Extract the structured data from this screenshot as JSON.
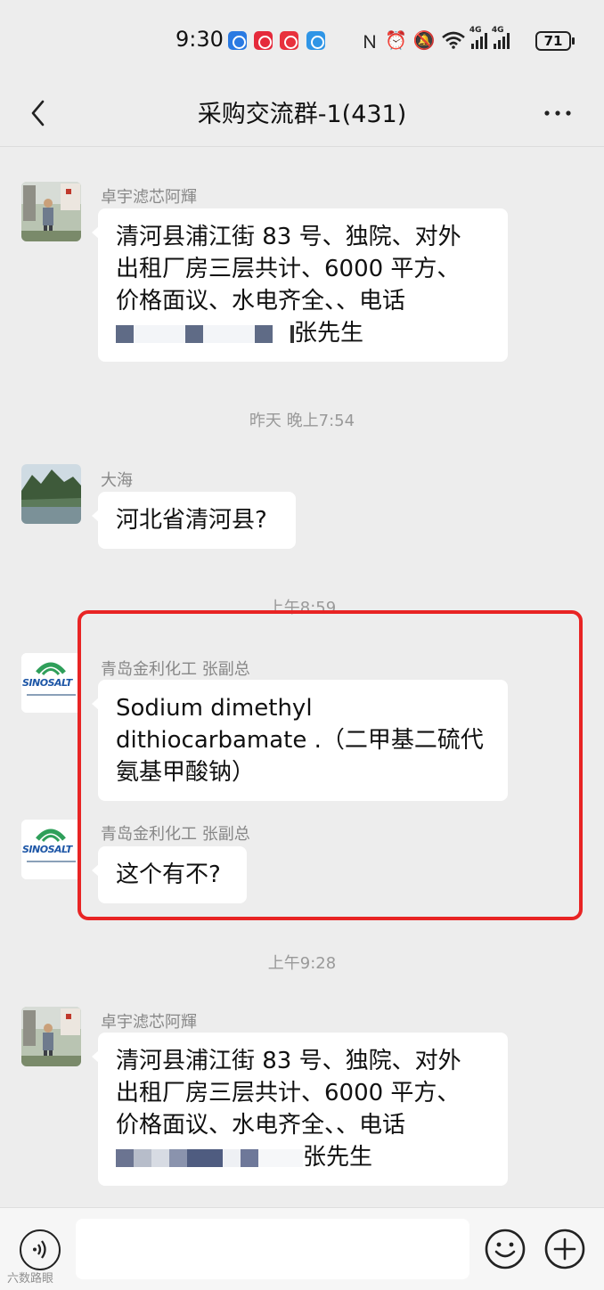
{
  "status_bar": {
    "time": "9:30",
    "battery": "71",
    "network_1": "4G",
    "network_2": "4G"
  },
  "header": {
    "title": "采购交流群-1(431)"
  },
  "messages": [
    {
      "sender": "卓宇滤芯阿輝",
      "lines": [
        "清河县浦江街 83 号、独院、对外",
        "出租厂房三层共计、6000 平方、",
        "价格面议、水电齐全、、电话"
      ],
      "last_line_suffix": "张先生"
    },
    {
      "timestamp": "昨天 晚上7:54"
    },
    {
      "sender": "大海",
      "lines": [
        "河北省清河县?"
      ]
    },
    {
      "timestamp": "上午8:59"
    },
    {
      "sender": "青岛金利化工 张副总",
      "avatar_text": "SINOSALT",
      "lines": [
        "Sodium dimethyl",
        "dithiocarbamate .（二甲基二硫代",
        "氨基甲酸钠）"
      ]
    },
    {
      "sender": "青岛金利化工 张副总",
      "avatar_text": "SINOSALT",
      "lines": [
        "这个有不?"
      ]
    },
    {
      "timestamp": "上午9:28"
    },
    {
      "sender": "卓宇滤芯阿輝",
      "lines": [
        "清河县浦江街 83 号、独院、对外",
        "出租厂房三层共计、6000 平方、",
        "价格面议、水电齐全、、电话"
      ],
      "last_line_suffix": "张先生"
    }
  ],
  "watermark": "六数路眼",
  "colors": {
    "highlight": "#e82424",
    "bubble": "#ffffff",
    "background": "#ededed"
  }
}
